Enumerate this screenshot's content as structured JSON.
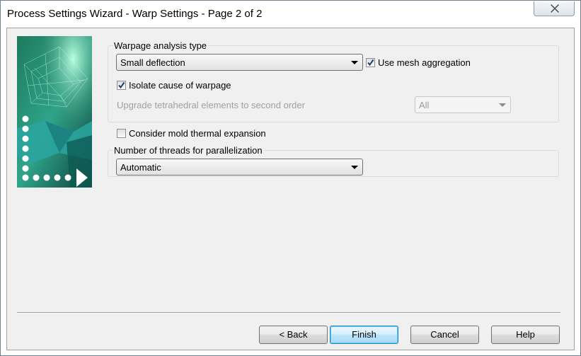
{
  "window": {
    "title": "Process Settings Wizard - Warp Settings - Page 2 of 2"
  },
  "warpage": {
    "group_label": "Warpage analysis type",
    "analysis_type_value": "Small deflection",
    "use_mesh_aggregation_label": "Use mesh aggregation",
    "use_mesh_aggregation_checked": true,
    "isolate_cause_label": "Isolate cause of warpage",
    "isolate_cause_checked": true,
    "upgrade_tetra_label": "Upgrade tetrahedral elements to second order",
    "upgrade_tetra_value": "All"
  },
  "mold_thermal": {
    "label": "Consider mold thermal expansion",
    "checked": false
  },
  "threads": {
    "group_label": "Number of threads for parallelization",
    "value": "Automatic"
  },
  "buttons": {
    "back": "< Back",
    "finish": "Finish",
    "cancel": "Cancel",
    "help": "Help"
  },
  "icons": {
    "close": "close-icon",
    "wizard_image": "wizard-mesh-image"
  }
}
